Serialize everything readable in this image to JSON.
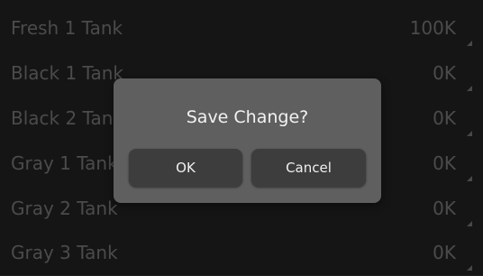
{
  "tanks": [
    {
      "label": "Fresh 1 Tank",
      "value": "100K"
    },
    {
      "label": "Black 1 Tank",
      "value": "0K"
    },
    {
      "label": "Black 2 Tank",
      "value": "0K"
    },
    {
      "label": "Gray 1 Tank",
      "value": "0K"
    },
    {
      "label": "Gray 2 Tank",
      "value": "0K"
    },
    {
      "label": "Gray 3 Tank",
      "value": "0K"
    }
  ],
  "dialog": {
    "title": "Save Change?",
    "ok_label": "OK",
    "cancel_label": "Cancel"
  },
  "colors": {
    "background": "#1f1f1f",
    "dialog": "#5f5f5f",
    "button": "#3d3d3d",
    "text_dim": "#6f6f6f"
  }
}
